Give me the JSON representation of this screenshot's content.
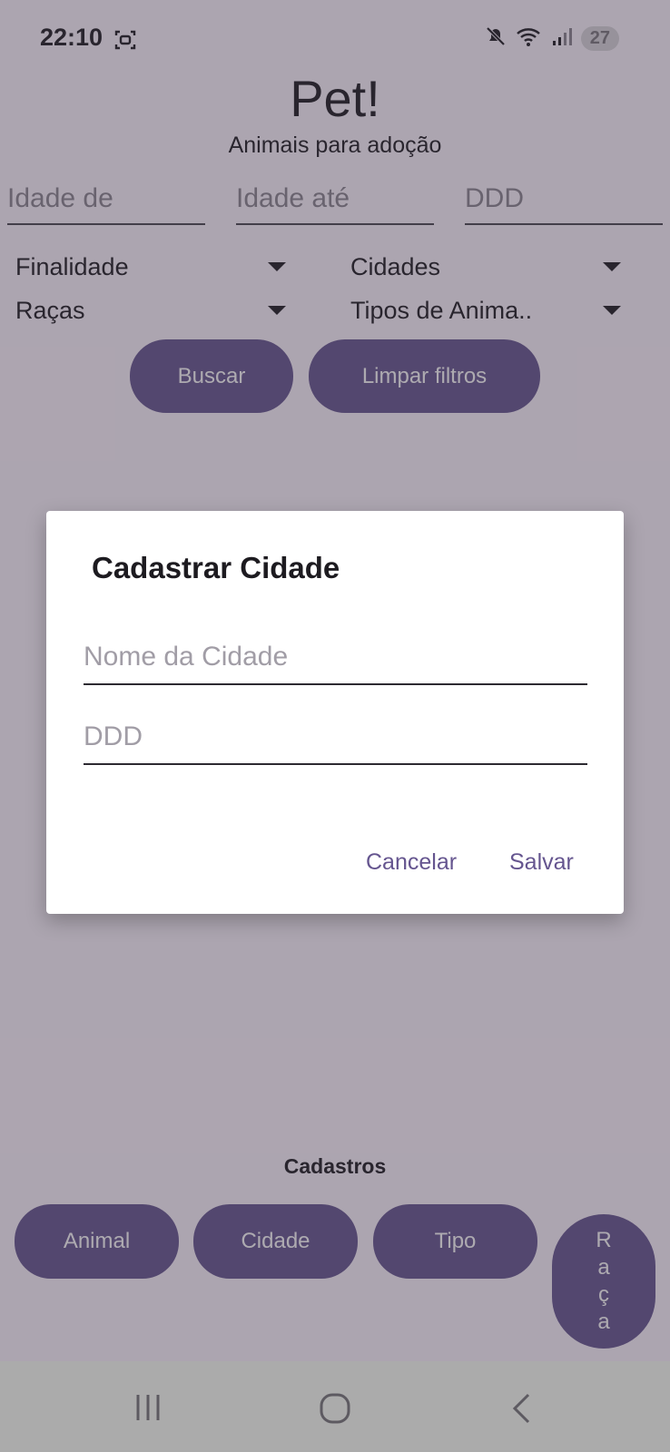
{
  "status_bar": {
    "time": "22:10",
    "battery": "27"
  },
  "header": {
    "title": "Pet!",
    "subtitle": "Animais para adoção"
  },
  "filters": {
    "idade_de_placeholder": "Idade de",
    "idade_ate_placeholder": "Idade até",
    "ddd_placeholder": "DDD",
    "finalidade": "Finalidade",
    "cidades": "Cidades",
    "racas": "Raças",
    "tipos": "Tipos de Anima.."
  },
  "actions": {
    "buscar": "Buscar",
    "limpar": "Limpar filtros"
  },
  "cadastros": {
    "label": "Cadastros",
    "animal": "Animal",
    "cidade": "Cidade",
    "tipo": "Tipo",
    "raca_chars": [
      "R",
      "a",
      "ç",
      "a"
    ]
  },
  "dialog": {
    "title": "Cadastrar Cidade",
    "nome_placeholder": "Nome da Cidade",
    "ddd_placeholder": "DDD",
    "cancel": "Cancelar",
    "save": "Salvar"
  },
  "colors": {
    "primary": "#65558f",
    "scrim": "rgba(60,52,66,0.42)",
    "surface": "#ffffff"
  }
}
